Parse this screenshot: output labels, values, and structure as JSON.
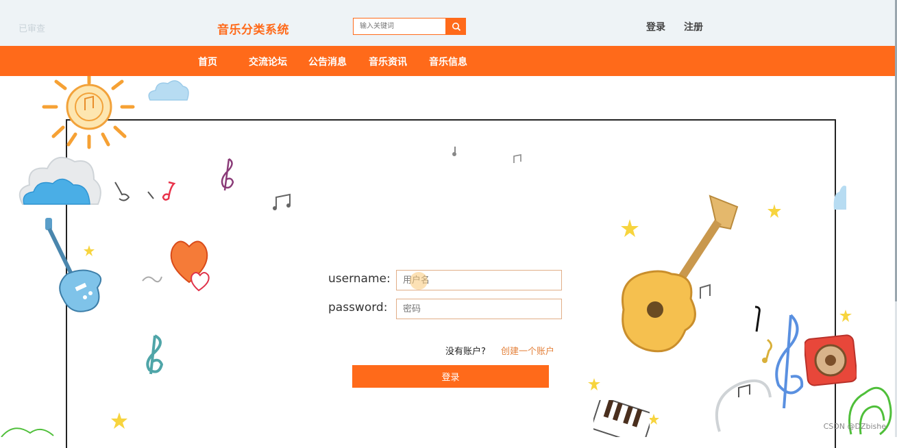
{
  "header": {
    "faint_text": "已审查",
    "site_title": "音乐分类系统",
    "search": {
      "placeholder": "输入关键词",
      "value": ""
    },
    "login_link": "登录",
    "register_link": "注册"
  },
  "nav": {
    "items": [
      {
        "label": "首页"
      },
      {
        "label": "交流论坛"
      },
      {
        "label": "公告消息"
      },
      {
        "label": "音乐资讯"
      },
      {
        "label": "音乐信息"
      }
    ]
  },
  "login_form": {
    "username_label": "username:",
    "username_placeholder": "用户名",
    "password_label": "password:",
    "password_placeholder": "密码",
    "no_account_text": "没有账户?",
    "create_account_link": "创建一个账户",
    "submit_label": "登录"
  },
  "watermark": "CSDN @DZbishe",
  "colors": {
    "accent": "#ff6a1a",
    "topbar_bg": "#eef3f6",
    "input_border": "#e1ad86"
  },
  "icons": [
    "search-icon",
    "sun-icon",
    "cloud-icon",
    "guitar-icon",
    "heart-icon",
    "music-note-icon",
    "treble-clef-icon",
    "star-icon",
    "speaker-icon",
    "piano-icon"
  ]
}
